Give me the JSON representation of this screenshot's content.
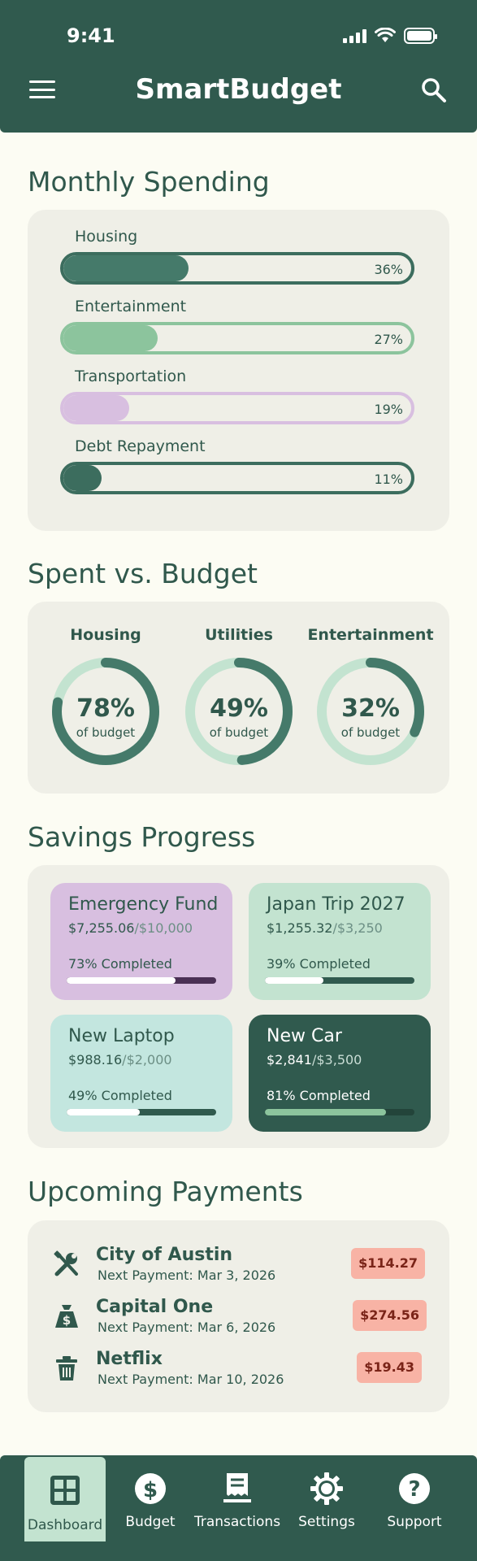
{
  "status": {
    "time": "9:41"
  },
  "header": {
    "title": "SmartBudget"
  },
  "monthly": {
    "title": "Monthly Spending",
    "items": [
      {
        "label": "Housing",
        "pct": "36%",
        "value": 36,
        "fill": "#457a6a",
        "border": "#3c6d5e"
      },
      {
        "label": "Entertainment",
        "pct": "27%",
        "value": 27,
        "fill": "#8cc49d",
        "border": "#8cc49d"
      },
      {
        "label": "Transportation",
        "pct": "19%",
        "value": 19,
        "fill": "#d8bfe0",
        "border": "#d8bfe0"
      },
      {
        "label": "Debt Repayment",
        "pct": "11%",
        "value": 11,
        "fill": "#3c6d5e",
        "border": "#3c6d5e"
      }
    ]
  },
  "spent": {
    "title": "Spent vs. Budget",
    "items": [
      {
        "label": "Housing",
        "pct": "78%",
        "value": 78,
        "sub": "of budget"
      },
      {
        "label": "Utilities",
        "pct": "49%",
        "value": 49,
        "sub": "of budget"
      },
      {
        "label": "Entertainment",
        "pct": "32%",
        "value": 32,
        "sub": "of budget"
      }
    ]
  },
  "savings": {
    "title": "Savings Progress",
    "goals": [
      {
        "name": "Emergency Fund",
        "saved": "$7,255.06",
        "target": "/$10,000",
        "pct_label": "73% Completed",
        "value": 73,
        "bg": "#d8bfe0",
        "text": "#30584c",
        "muted": "#6c8f85",
        "track": "#4a3054",
        "fill": "#ffffff"
      },
      {
        "name": "Japan Trip 2027",
        "saved": "$1,255.32",
        "target": "/$3,250",
        "pct_label": "39% Completed",
        "value": 39,
        "bg": "#c3e3d0",
        "text": "#30584c",
        "muted": "#6c8f85",
        "track": "#305a4e",
        "fill": "#ffffff"
      },
      {
        "name": "New Laptop",
        "saved": "$988.16",
        "target": "/$2,000",
        "pct_label": "49% Completed",
        "value": 49,
        "bg": "#c3e6df",
        "text": "#30584c",
        "muted": "#6c8f85",
        "track": "#305a4e",
        "fill": "#ffffff"
      },
      {
        "name": "New Car",
        "saved": "$2,841",
        "target": "/$3,500",
        "pct_label": "81% Completed",
        "value": 81,
        "bg": "#305a4e",
        "text": "#ffffff",
        "muted": "#c9ddd5",
        "track": "#23443a",
        "fill": "#8cc49d"
      }
    ]
  },
  "payments": {
    "title": "Upcoming Payments",
    "items": [
      {
        "name": "City of Austin",
        "date": "Next Payment: Mar 3, 2026",
        "amount": "$114.27",
        "icon": "tools-icon"
      },
      {
        "name": "Capital One",
        "date": "Next Payment: Mar 6, 2026",
        "amount": "$274.56",
        "icon": "money-bag-icon"
      },
      {
        "name": "Netflix",
        "date": "Next Payment: Mar 10, 2026",
        "amount": "$19.43",
        "icon": "trash-icon"
      }
    ]
  },
  "nav": {
    "items": [
      {
        "label": "Dashboard",
        "icon": "dashboard-icon",
        "active": true
      },
      {
        "label": "Budget",
        "icon": "dollar-icon"
      },
      {
        "label": "Transactions",
        "icon": "receipt-icon"
      },
      {
        "label": "Settings",
        "icon": "gear-icon"
      },
      {
        "label": "Support",
        "icon": "help-icon"
      }
    ]
  },
  "colors": {
    "primary": "#305a4e",
    "background": "#fcfcf3",
    "card": "#efefe7",
    "ring_track": "#c3e3d0",
    "ring_fill": "#457a6a",
    "payment_badge": "#f8b3a5"
  }
}
